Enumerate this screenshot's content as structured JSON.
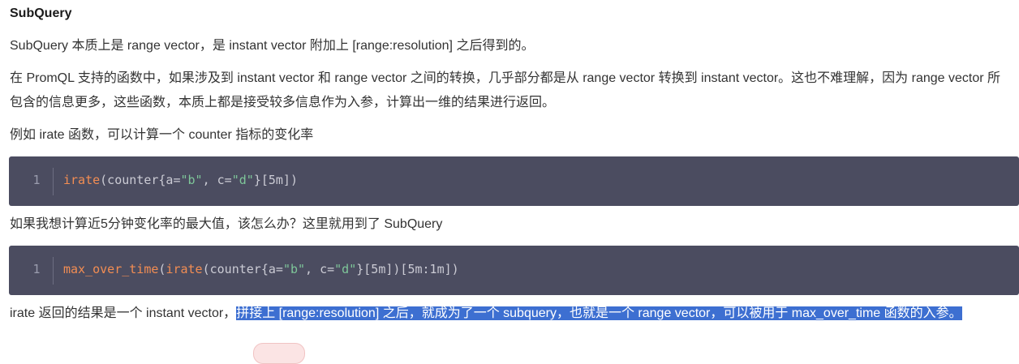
{
  "heading": "SubQuery",
  "paragraphs": {
    "p1": "SubQuery 本质上是 range vector，是 instant vector 附加上 [range:resolution] 之后得到的。",
    "p2": "在 PromQL 支持的函数中，如果涉及到 instant vector 和 range vector 之间的转换，几乎部分都是从 range vector 转换到 instant vector。这也不难理解，因为 range vector 所包含的信息更多，这些函数，本质上都是接受较多信息作为入参，计算出一维的结果进行返回。",
    "p3": "例如 irate 函数，可以计算一个 counter 指标的变化率",
    "p4": "如果我想计算近5分钟变化率的最大值，该怎么办？这里就用到了 SubQuery",
    "p5_plain": "irate 返回的结果是一个 instant vector，",
    "p5_selected": "拼接上 [range:resolution] 之后，就成为了一个 subquery，也就是一个 range vector，可以被用于 max_over_time 函数的入参。"
  },
  "code1": {
    "line_number": "1",
    "fn": "irate",
    "t1": "(counter{a=",
    "s1": "\"b\"",
    "t2": ", c=",
    "s2": "\"d\"",
    "t3": "}[5m])"
  },
  "code2": {
    "line_number": "1",
    "fn1": "max_over_time",
    "t0": "(",
    "fn2": "irate",
    "t1": "(counter{a=",
    "s1": "\"b\"",
    "t2": ", c=",
    "s2": "\"d\"",
    "t3": "}[5m])[5m:1m])"
  },
  "colors": {
    "code_background": "#4b4c60",
    "code_function": "#f28d53",
    "code_string": "#7ec699",
    "code_text": "#cbcbd4",
    "selection_highlight": "#3d6fd1"
  }
}
